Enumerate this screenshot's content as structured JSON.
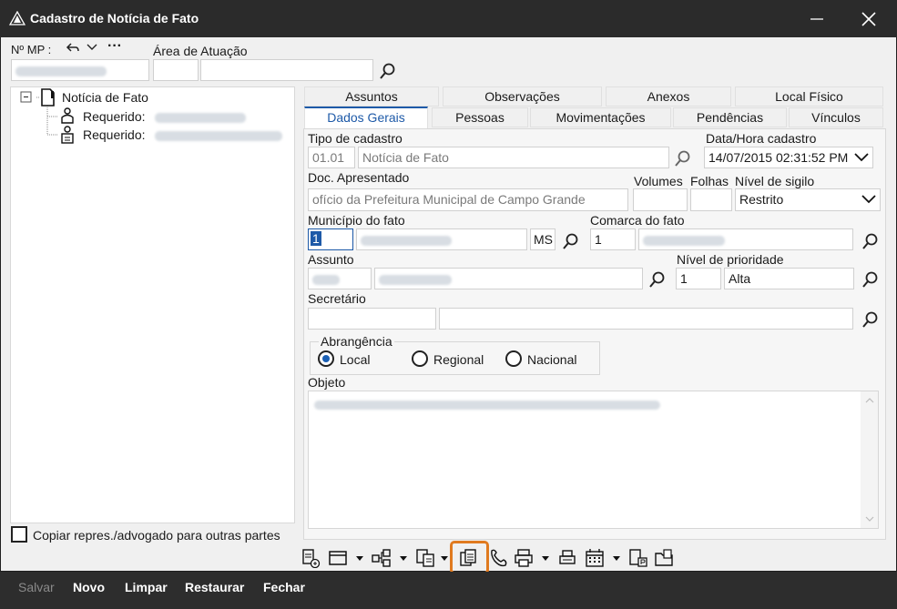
{
  "window": {
    "title": "Cadastro de Notícia de Fato"
  },
  "header": {
    "nmp_label": "Nº MP :",
    "area_label": "Área de Atuação"
  },
  "tree": {
    "root": "Notícia de Fato",
    "children": [
      {
        "label": "Requerido:"
      },
      {
        "label": "Requerido:"
      }
    ]
  },
  "copy_checkbox": {
    "label": "Copiar repres./advogado para outras partes",
    "checked": false
  },
  "tabs": {
    "row1": [
      "Assuntos",
      "Observações",
      "Anexos",
      "Local Físico"
    ],
    "row2": [
      "Dados Gerais",
      "Pessoas",
      "Movimentações",
      "Pendências",
      "Vínculos"
    ],
    "active": "Dados Gerais"
  },
  "form": {
    "tipo_label": "Tipo de cadastro",
    "tipo_code": "01.01",
    "tipo_value": "Notícia de Fato",
    "datahora_label": "Data/Hora cadastro",
    "datahora_value": "14/07/2015 02:31:52 PM",
    "doc_label": "Doc. Apresentado",
    "doc_value": "ofício da Prefeitura Municipal de Campo Grande",
    "volumes_label": "Volumes",
    "folhas_label": "Folhas",
    "sigilo_label": "Nível de sigilo",
    "sigilo_value": "Restrito",
    "municipio_label": "Município do fato",
    "municipio_code": "1",
    "uf": "MS",
    "comarca_label": "Comarca do fato",
    "comarca_code": "1",
    "assunto_label": "Assunto",
    "prioridade_label": "Nível de prioridade",
    "prioridade_code": "1",
    "prioridade_value": "Alta",
    "secretario_label": "Secretário",
    "abrangencia_label": "Abrangência",
    "abrangencia_options": [
      "Local",
      "Regional",
      "Nacional"
    ],
    "abrangencia_selected": "Local",
    "objeto_label": "Objeto"
  },
  "actions": [
    "Salvar",
    "Novo",
    "Limpar",
    "Restaurar",
    "Fechar"
  ],
  "colors": {
    "highlight": "#e07a1f",
    "accent": "#1e5aa8",
    "titlebar": "#2b2b2b"
  }
}
